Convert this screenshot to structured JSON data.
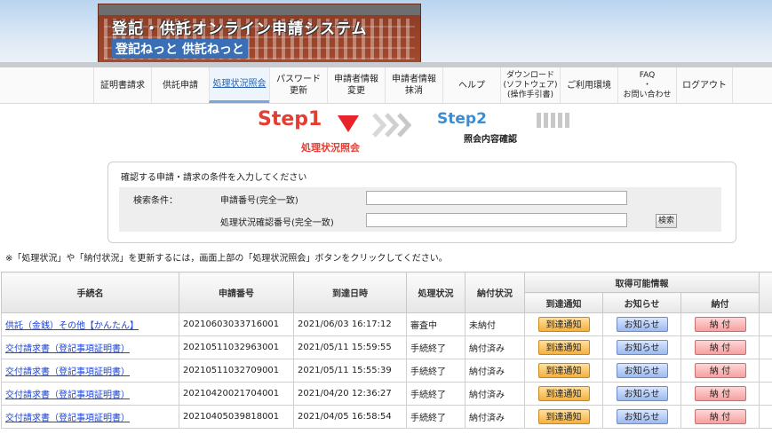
{
  "header": {
    "title": "登記・供託オンライン申請システム",
    "subtitle": "登記ねっと 供託ねっと"
  },
  "nav": {
    "items": [
      {
        "label": "証明書請求"
      },
      {
        "label": "供託申請"
      },
      {
        "label": "処理状況照会"
      },
      {
        "label": "パスワード\n更新"
      },
      {
        "label": "申請者情報\n変更"
      },
      {
        "label": "申請者情報\n抹消"
      },
      {
        "label": "ヘルプ"
      },
      {
        "label": "ダウンロード\n(ソフトウェア)\n(操作手引書)"
      },
      {
        "label": "ご利用環境"
      },
      {
        "label": "FAQ\n・\nお問い合わせ"
      },
      {
        "label": "ログアウト"
      }
    ],
    "active": "処理状況照会"
  },
  "steps": {
    "step1": "Step1",
    "step1_label": "処理状況照会",
    "step2": "Step2",
    "step2_label": "照会内容確認"
  },
  "search": {
    "instruction": "確認する申請・請求の条件を入力してください",
    "condition_label": "検索条件：",
    "field1_label": "申請番号(完全一致)",
    "field2_label": "処理状況確認番号(完全一致)",
    "field1_value": "",
    "field2_value": "",
    "button_label": "検索"
  },
  "note": "※「処理状況」や「納付状況」を更新するには，画面上部の「処理状況照会」ボタンをクリックしてください。",
  "table": {
    "headers": {
      "name": "手続名",
      "number": "申請番号",
      "date": "到達日時",
      "status": "処理状況",
      "payment": "納付状況",
      "group": "取得可能情報",
      "arrival": "到達通知",
      "notice": "お知らせ",
      "pay": "納付"
    },
    "rows": [
      {
        "name": "供託（金銭）その他【かんたん】",
        "number": "20210603033716001",
        "date": "2021/06/03 16:17:12",
        "status": "審査中",
        "payment": "未納付",
        "b1": "到達通知",
        "b2": "お知らせ",
        "b3": "納 付"
      },
      {
        "name": "交付請求書（登記事項証明書）",
        "number": "20210511032963001",
        "date": "2021/05/11 15:59:55",
        "status": "手続終了",
        "payment": "納付済み",
        "b1": "到達通知",
        "b2": "お知らせ",
        "b3": "納 付"
      },
      {
        "name": "交付請求書（登記事項証明書）",
        "number": "20210511032709001",
        "date": "2021/05/11 15:55:39",
        "status": "手続終了",
        "payment": "納付済み",
        "b1": "到達通知",
        "b2": "お知らせ",
        "b3": "納 付"
      },
      {
        "name": "交付請求書（登記事項証明書）",
        "number": "20210420021704001",
        "date": "2021/04/20 12:36:27",
        "status": "手続終了",
        "payment": "納付済み",
        "b1": "到達通知",
        "b2": "お知らせ",
        "b3": "納 付"
      },
      {
        "name": "交付請求書（登記事項証明書）",
        "number": "20210405039818001",
        "date": "2021/04/05 16:58:54",
        "status": "手続終了",
        "payment": "納付済み",
        "b1": "到達通知",
        "b2": "お知らせ",
        "b3": "納 付"
      }
    ]
  },
  "colors": {
    "step1": "#e43e33",
    "step2": "#3c8ccf",
    "link": "#1a44d8",
    "arrival_btn": "#f5b040",
    "notice_btn": "#9dbaf0",
    "pay_btn": "#f5a0a0"
  }
}
